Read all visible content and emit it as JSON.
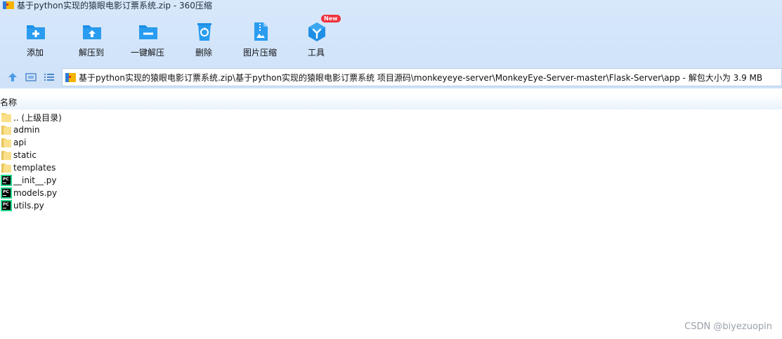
{
  "window": {
    "title": "基于python实现的猿眼电影订票系统.zip - 360压缩"
  },
  "toolbar": {
    "items": [
      {
        "label": "添加",
        "icon": "add-icon"
      },
      {
        "label": "解压到",
        "icon": "extract-to-icon"
      },
      {
        "label": "一键解压",
        "icon": "one-click-extract-icon"
      },
      {
        "label": "删除",
        "icon": "delete-icon"
      },
      {
        "label": "图片压缩",
        "icon": "image-compress-icon"
      },
      {
        "label": "工具",
        "icon": "tools-icon",
        "badge": "New"
      }
    ]
  },
  "nav": {
    "path": "基于python实现的猿眼电影订票系统.zip\\基于python实现的猿眼电影订票系统 项目源码\\monkeyeye-server\\MonkeyEye-Server-master\\Flask-Server\\app - 解包大小为 3.9 MB"
  },
  "list": {
    "column_name": "名称",
    "items": [
      {
        "name": ".. (上级目录)",
        "type": "parent-folder"
      },
      {
        "name": "admin",
        "type": "folder"
      },
      {
        "name": "api",
        "type": "folder"
      },
      {
        "name": "static",
        "type": "folder"
      },
      {
        "name": "templates",
        "type": "folder"
      },
      {
        "name": "__init__.py",
        "type": "py"
      },
      {
        "name": "models.py",
        "type": "py"
      },
      {
        "name": "utils.py",
        "type": "py"
      }
    ]
  },
  "watermark": "CSDN @biyezuopin",
  "colors": {
    "accent": "#1f8fe6",
    "badge": "#f0323c",
    "toolbar_bg": "#d3e5fa"
  }
}
